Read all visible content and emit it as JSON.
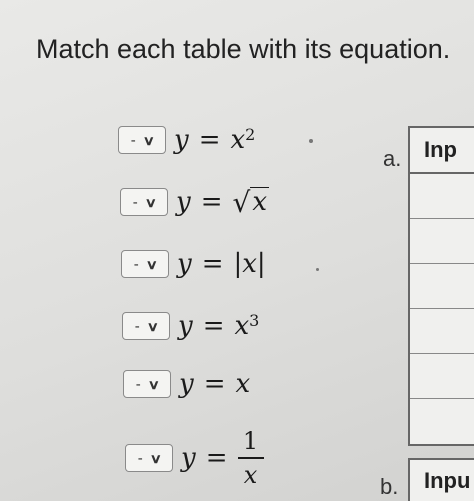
{
  "title": "Match each table with its equation.",
  "dropdown": {
    "placeholder": "-",
    "chevron": "chevron-down-icon"
  },
  "equations": [
    {
      "lhs": "y",
      "op": "=",
      "rhs": "x",
      "exponent": "2"
    },
    {
      "lhs": "y",
      "op": "=",
      "rhs": "x",
      "radical": "√"
    },
    {
      "lhs": "y",
      "op": "=",
      "rhs": "|x|"
    },
    {
      "lhs": "y",
      "op": "=",
      "rhs": "x",
      "exponent": "3"
    },
    {
      "lhs": "y",
      "op": "=",
      "rhs": "x"
    },
    {
      "lhs": "y",
      "op": "=",
      "numerator": "1",
      "denominator": "x"
    }
  ],
  "tables": [
    {
      "label": "a.",
      "header": "Inp",
      "rows": 6
    },
    {
      "label": "b.",
      "header": "Inpu"
    }
  ]
}
